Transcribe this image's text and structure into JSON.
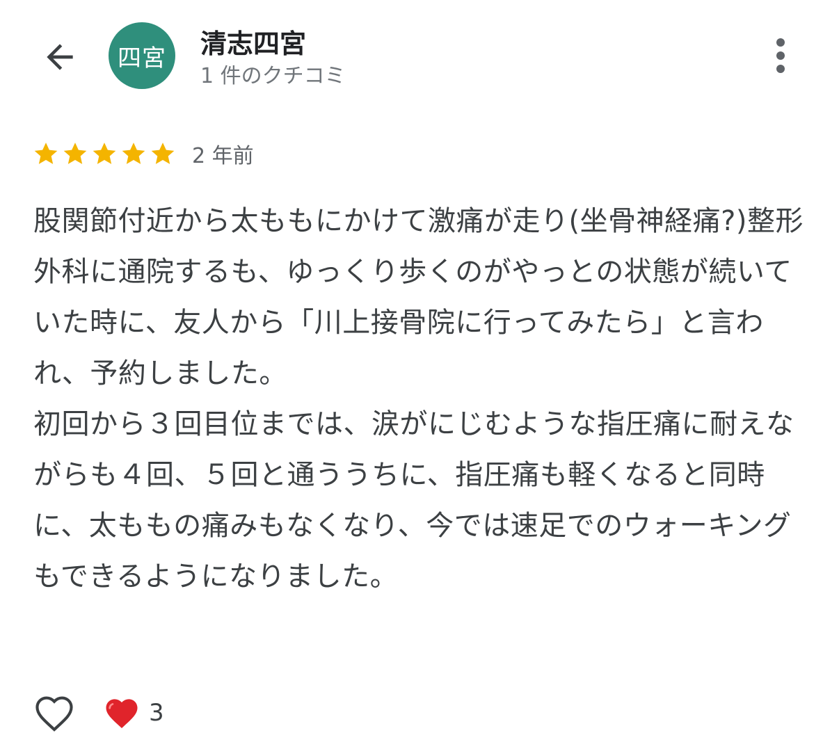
{
  "header": {
    "back_icon": "arrow-left-icon",
    "avatar_text": "四宮",
    "avatar_color": "#2f8f7c",
    "reviewer_name": "清志四宮",
    "review_count": "1 件のクチコミ",
    "more_icon": "more-vertical-icon"
  },
  "review": {
    "rating": 5,
    "rating_max": 5,
    "star_color": "#f4b400",
    "time_ago": "2 年前",
    "text": "股関節付近から太ももにかけて激痛が走り(坐骨神経痛?)整形外科に通院するも、ゆっくり歩くのがやっとの状態が続いていた時に、友人から「川上接骨院に行ってみたら」と言われ、予約しました。\n初回から３回目位までは、涙がにじむような指圧痛に耐えながらも４回、５回と通ううちに、指圧痛も軽くなると同時に、太ももの痛みもなくなり、今では速足でのウォーキングもできるようになりました。"
  },
  "footer": {
    "like_icon": "heart-outline-icon",
    "reaction_icon": "red-heart-icon",
    "reaction_count": "3"
  }
}
